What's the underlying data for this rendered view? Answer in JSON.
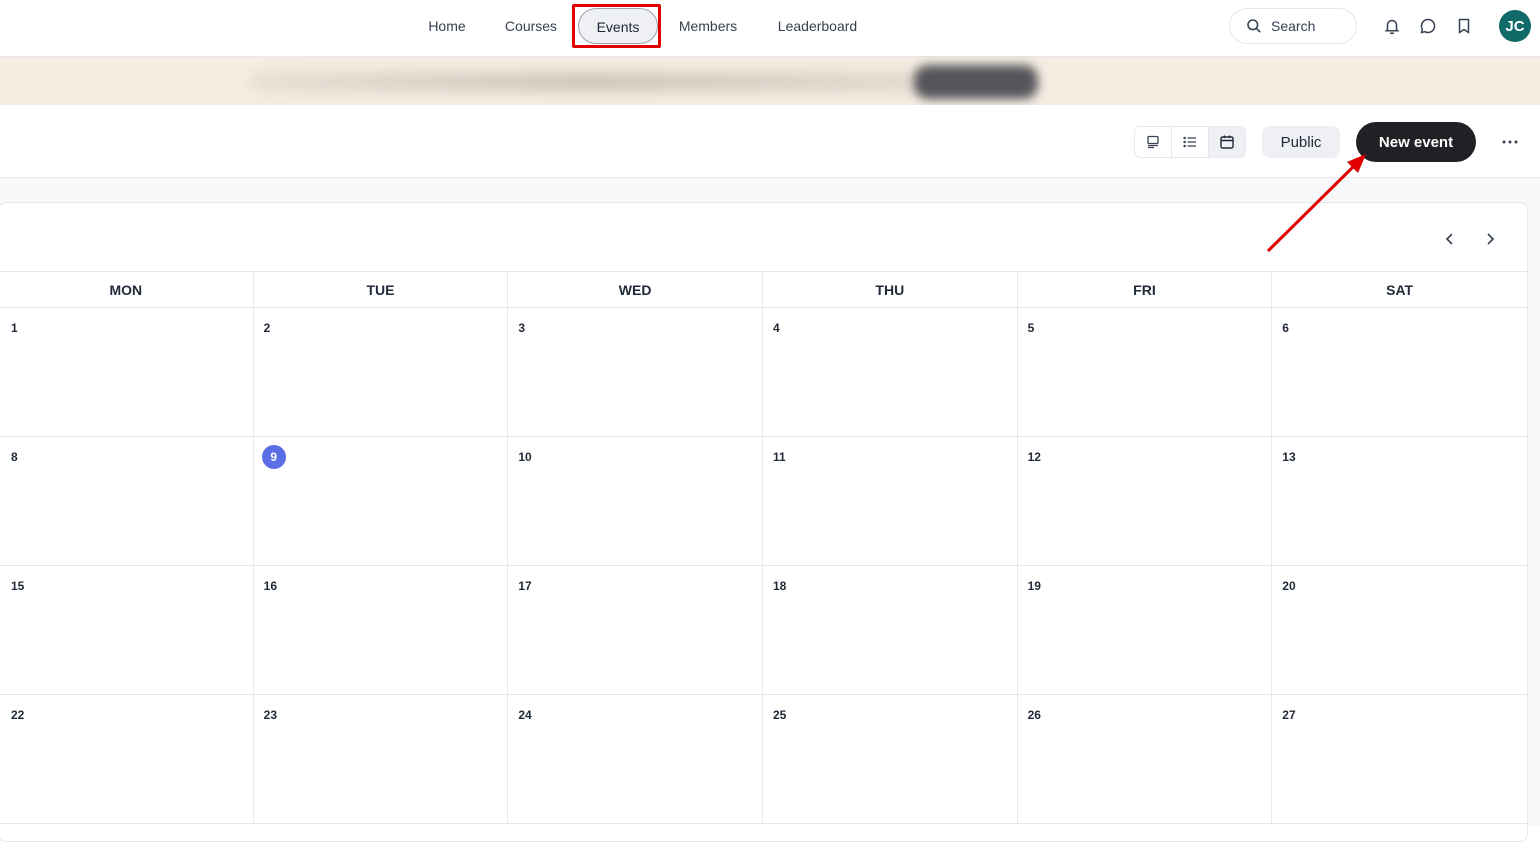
{
  "nav": {
    "items": [
      {
        "label": "Home",
        "active": false
      },
      {
        "label": "Courses",
        "active": false
      },
      {
        "label": "Events",
        "active": true
      },
      {
        "label": "Members",
        "active": false
      },
      {
        "label": "Leaderboard",
        "active": false
      }
    ],
    "search_label": "Search",
    "avatar_initials": "JC",
    "avatar_color": "#0f6a68"
  },
  "toolbar": {
    "view_modes": [
      "card-view-icon",
      "list-view-icon",
      "calendar-view-icon"
    ],
    "active_view": "calendar",
    "public_label": "Public",
    "new_event_label": "New event"
  },
  "calendar": {
    "weekdays": [
      "MON",
      "TUE",
      "WED",
      "THU",
      "FRI",
      "SAT"
    ],
    "weeks": [
      [
        "1",
        "2",
        "3",
        "4",
        "5",
        "6"
      ],
      [
        "8",
        "9",
        "10",
        "11",
        "12",
        "13"
      ],
      [
        "15",
        "16",
        "17",
        "18",
        "19",
        "20"
      ],
      [
        "22",
        "23",
        "24",
        "25",
        "26",
        "27"
      ]
    ],
    "today": "9",
    "today_color": "#5a6ee6"
  },
  "annotation_color": "#e00000"
}
